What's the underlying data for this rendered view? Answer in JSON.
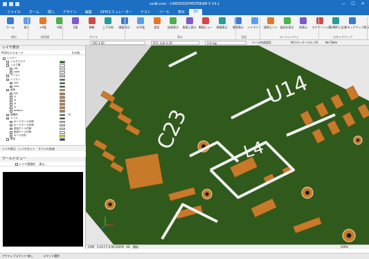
{
  "window": {
    "title": "xxdb.com - CAM350/DFMSTREAM V 14.1",
    "minimize": "—",
    "maximize": "☐",
    "close": "✕"
  },
  "tabs": [
    "ファイル",
    "ホーム",
    "挿入",
    "デザイン",
    "編集",
    "DFMエミュレーター",
    "テスト",
    "ツール",
    "表示",
    "3D"
  ],
  "ribbon": {
    "buttons": [
      "ホーム",
      "表示",
      "+X面",
      "-X面",
      "Z面",
      "移動",
      "上下方向",
      "隠面表示",
      "水平面",
      "設定",
      "拡張表示",
      "表面と表示",
      "断面ビュー",
      "透過表示",
      "通常表示",
      "ハイライト",
      "接続ヒント",
      "部品を表示",
      "再表示",
      "スクリーンショット",
      "3D PDFに出力",
      "スタックアップ表示ツール"
    ],
    "groups": [
      "視点",
      "前回値",
      "カメラ",
      "表示",
      "部品",
      "ユーティリティ",
      "スタックアップ"
    ]
  },
  "optionbar": {
    "view_value": "100 3.00",
    "tool_value": "D11  丸形 0.30",
    "layer_value": "1:A top",
    "mode_value": "ツール作成設定",
    "net_label": "Wクローチーブル: 01",
    "net_value": "No Table"
  },
  "layer_panel": {
    "title": "レイヤ表示",
    "toolbar": "PCBモデルモード",
    "toolbar_more": "その他...",
    "columns": [
      "レイヤー",
      "色",
      "透過性"
    ],
    "rows": [
      {
        "name": "レイヤー",
        "color": "",
        "value": "",
        "indent": 0
      },
      {
        "name": "ソルダマスク",
        "color": "#2d6b1e",
        "value": "",
        "indent": 1
      },
      {
        "name": "シルク層",
        "color": "#ffffff",
        "value": "",
        "indent": 1
      },
      {
        "name": "silk",
        "color": "#e8e8e8",
        "value": "",
        "indent": 2
      },
      {
        "name": "silkb",
        "color": "#e8e8e8",
        "value": "",
        "indent": 2
      },
      {
        "name": "ペースト",
        "color": "#c8c8c8",
        "value": "",
        "indent": 1
      },
      {
        "name": "レジスト",
        "color": "#2d6b1e",
        "value": "",
        "indent": 1
      },
      {
        "name": "smt",
        "color": "#1e5a12",
        "value": "",
        "indent": 2
      },
      {
        "name": "smb",
        "color": "#1e5a12",
        "value": "",
        "indent": 2
      },
      {
        "name": "導体",
        "color": "#c87a2a",
        "value": "",
        "indent": 1
      },
      {
        "name": "top",
        "color": "#c87a2a",
        "value": "",
        "indent": 2
      },
      {
        "name": "l2",
        "color": "#c87a2a",
        "value": "",
        "indent": 2
      },
      {
        "name": "l3",
        "color": "#c87a2a",
        "value": "",
        "indent": 2
      },
      {
        "name": "l4",
        "color": "#c87a2a",
        "value": "",
        "indent": 2
      },
      {
        "name": "l5",
        "color": "#c87a2a",
        "value": "",
        "indent": 2
      },
      {
        "name": "bottom",
        "color": "#c87a2a",
        "value": "",
        "indent": 2
      },
      {
        "name": "誘電体",
        "color": "#7a6a2a",
        "value": "50",
        "indent": 1
      },
      {
        "name": "ドリル",
        "color": "#3a3a3a",
        "value": "",
        "indent": 1
      },
      {
        "name": "ボードホール内側",
        "color": "#c8c8c8",
        "value": "",
        "indent": 2
      },
      {
        "name": "ボードホール外側",
        "color": "#c8c8c8",
        "value": "",
        "indent": 2
      },
      {
        "name": "部品ホール内側",
        "color": "#e8e8e8",
        "value": "",
        "indent": 2
      },
      {
        "name": "部品ホール外側",
        "color": "#e8e8e8",
        "value": "",
        "indent": 2
      },
      {
        "name": "ボード外形",
        "color": "#f0e000",
        "value": "",
        "indent": 2
      },
      {
        "name": "部品",
        "color": "#1a3a8a",
        "value": "",
        "indent": 1
      }
    ],
    "bottom_tabs": [
      "レイヤ表示",
      "レイヤセット",
      "ファイル合成"
    ]
  },
  "world_view": {
    "title": "ワールドビュー",
    "checkbox_label": "レイヤ透過性",
    "display_label": "表示..."
  },
  "canvas": {
    "labels": {
      "u14": "U14",
      "c23": "C23",
      "l4": "L4"
    },
    "colors": {
      "board": "#2f5a1c",
      "copper": "#c87a2a",
      "silk": "#f2f2f2",
      "bg": "#e6e6e6"
    }
  },
  "bottombar": {
    "cam": "CAM",
    "coords": "3.25 C7 0.00 R",
    "dfm": "DFM",
    "mode3d": "3D",
    "open": "開始",
    "zoom": "100%"
  },
  "statusbar": {
    "left": "アクティブコマンド:",
    "middle": "無し",
    "right": "コマンド選択"
  }
}
